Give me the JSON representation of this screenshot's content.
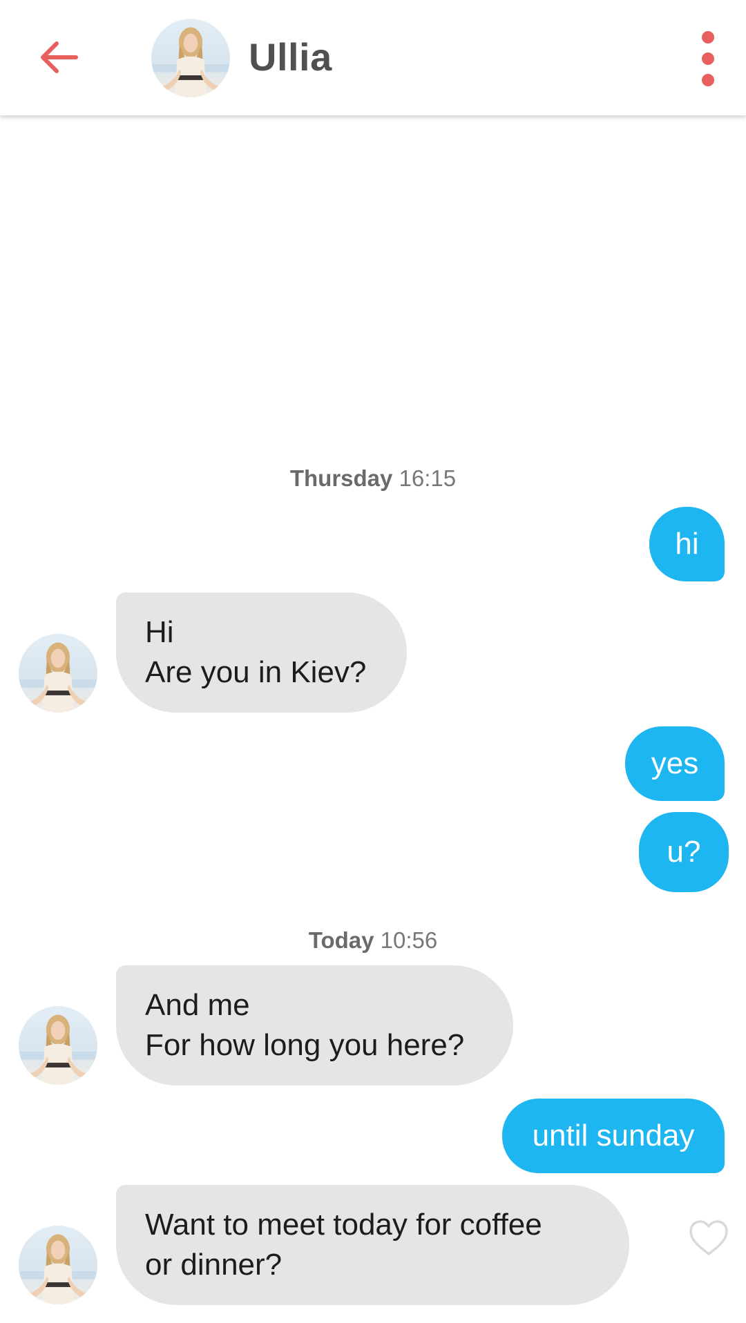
{
  "header": {
    "contact_name": "Ullia",
    "back_icon": "arrow-left-icon",
    "menu_icon": "more-vertical-icon",
    "accent_color": "#e8605d"
  },
  "conversation": {
    "groups": [
      {
        "day": "Thursday",
        "time": "16:15"
      },
      {
        "day": "Today",
        "time": "10:56"
      }
    ],
    "messages": [
      {
        "direction": "out",
        "lines": [
          "hi"
        ]
      },
      {
        "direction": "in",
        "lines": [
          "Hi",
          "Are you in Kiev?"
        ]
      },
      {
        "direction": "out",
        "lines": [
          "yes"
        ]
      },
      {
        "direction": "out",
        "lines": [
          "u?"
        ]
      },
      {
        "direction": "in",
        "lines": [
          "And me",
          "For how long you here?"
        ]
      },
      {
        "direction": "out",
        "lines": [
          "until sunday"
        ]
      },
      {
        "direction": "in",
        "lines": [
          "Want to meet today for coffee",
          "or dinner?"
        ]
      }
    ],
    "outgoing_color": "#1eb6f0",
    "incoming_color": "#e5e5e5",
    "like_icon": "heart-outline-icon"
  }
}
